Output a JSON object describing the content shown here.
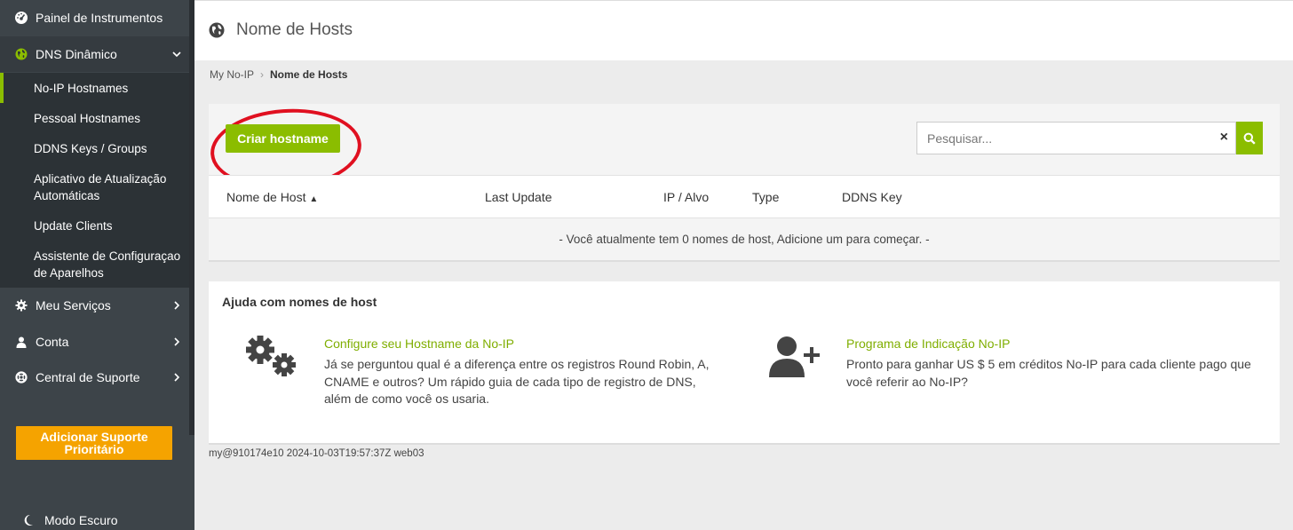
{
  "sidebar": {
    "items": [
      {
        "label": "Painel de Instrumentos",
        "icon": "dashboard-icon"
      },
      {
        "label": "DNS Dinâmico",
        "icon": "globe-icon"
      },
      {
        "label": "Meu Serviços",
        "icon": "gear-icon"
      },
      {
        "label": "Conta",
        "icon": "user-icon"
      },
      {
        "label": "Central de Suporte",
        "icon": "lifebuoy-icon"
      }
    ],
    "dns_submenu": [
      "No-IP Hostnames",
      "Pessoal Hostnames",
      "DDNS Keys / Groups",
      "Aplicativo de Atualização Automáticas",
      "Update Clients",
      "Assistente de Configuraçao de Aparelhos"
    ],
    "support_button": "Adicionar Suporte Prioritário",
    "dark_mode": "Modo Escuro"
  },
  "header": {
    "title": "Nome de Hosts"
  },
  "breadcrumb": {
    "root": "My No-IP",
    "current": "Nome de Hosts"
  },
  "toolbar": {
    "create_label": "Criar hostname",
    "search_placeholder": "Pesquisar...",
    "clear_symbol": "×"
  },
  "table": {
    "columns": [
      "Nome de Host",
      "Last Update",
      "IP / Alvo",
      "Type",
      "DDNS Key"
    ],
    "sort_indicator": "▲",
    "empty_message": "- Você atualmente tem 0 nomes de host, Adicione um para começar. -"
  },
  "help": {
    "title": "Ajuda com nomes de host",
    "items": [
      {
        "title": "Configure seu Hostname da No-IP",
        "text": "Já se perguntou qual é a diferença entre os registros Round Robin, A, CNAME e outros? Um rápido guia de cada tipo de registro de DNS, além de como você os usaria.",
        "icon": "gears-icon"
      },
      {
        "title": "Programa de Indicação No-IP",
        "text": "Pronto para ganhar US $ 5 em créditos No-IP para cada cliente pago que você referir ao No-IP?",
        "icon": "add-user-icon"
      }
    ]
  },
  "footer": {
    "meta": "my@910174e10 2024-10-03T19:57:37Z web03"
  },
  "colors": {
    "accent": "#8bbd00",
    "support": "#f5a300",
    "sidebar": "#3d4449",
    "annotation": "#e01020"
  }
}
